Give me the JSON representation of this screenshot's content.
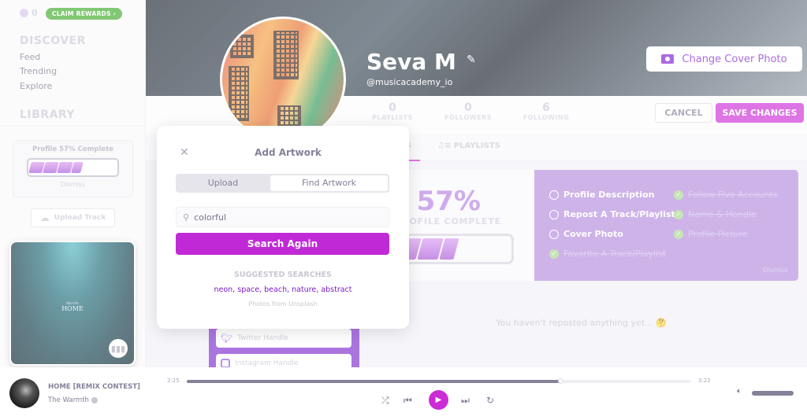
{
  "sidebar": {
    "points": "0",
    "claim_rewards": "CLAIM REWARDS",
    "discover": "DISCOVER",
    "links": [
      "Feed",
      "Trending",
      "Explore"
    ],
    "library": "LIBRARY",
    "profile_card": {
      "title": "Profile 57% Complete",
      "dismiss": "Dismiss",
      "progress_percent": 57
    },
    "upload": "Upload Track",
    "album_art": {
      "artist": "Warmth",
      "title": "HOME"
    }
  },
  "profile": {
    "name": "Seva M",
    "handle": "@musicacademy_io",
    "change_cover": "Change Cover Photo",
    "stats": [
      {
        "value": "0",
        "label": "PLAYLISTS"
      },
      {
        "value": "0",
        "label": "FOLLOWERS"
      },
      {
        "value": "6",
        "label": "FOLLOWING"
      }
    ],
    "cancel": "CANCEL",
    "save": "SAVE CHANGES"
  },
  "tabs": {
    "active_partial": "S",
    "playlists": "PLAYLISTS"
  },
  "completion": {
    "percent": "57%",
    "label": "PROFILE COMPLETE",
    "progress_percent": 57,
    "dismiss": "Dismiss",
    "todo": [
      "Profile Description",
      "Repost A Track/Playlist",
      "Cover Photo"
    ],
    "done": [
      "Follow Five Accounts",
      "Name & Handle",
      "Profile Picture",
      "Favorite A Track/Playlist"
    ]
  },
  "reposts_empty": "You haven't reposted anything yet... 🤔",
  "social": {
    "twitter": "Twitter Handle",
    "instagram": "Instagram Handle"
  },
  "modal": {
    "title": "Add Artwork",
    "tabs": [
      "Upload",
      "Find Artwork"
    ],
    "active_tab": "Find Artwork",
    "search_value": "colorful",
    "search_button": "Search Again",
    "suggested_title": "SUGGESTED SEARCHES",
    "suggestions": "neon, space, beach, nature, abstract",
    "credit": "Photos from Unsplash"
  },
  "player": {
    "title": "HOME [REMIX CONTEST]",
    "artist": "The Warmth",
    "elapsed": "2:25",
    "duration": "3:22",
    "progress_fraction": 0.74,
    "volume_fraction": 1.0
  },
  "colors": {
    "accent": "#cc2bd8",
    "purple_panel": "#b48ade",
    "claim_green": "#3eab2a",
    "link_purple": "#7e1bcc"
  }
}
